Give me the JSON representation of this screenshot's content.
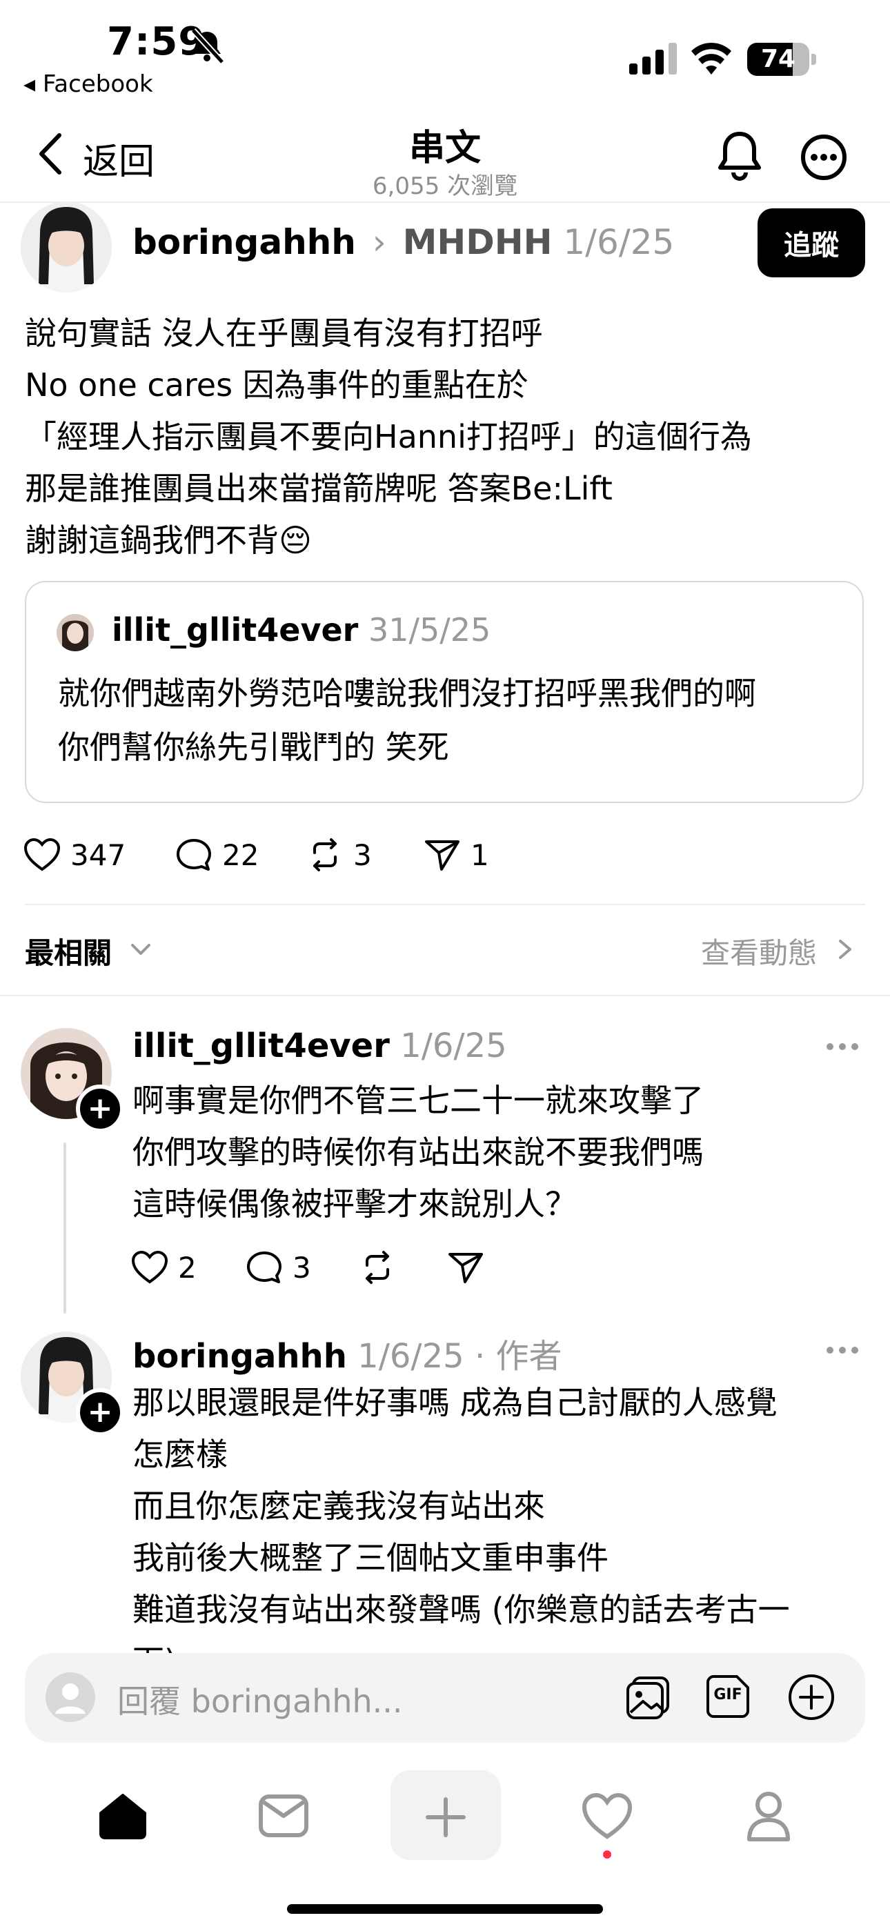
{
  "status_bar": {
    "time": "7:59",
    "back_app": "◂ Facebook",
    "battery": "74"
  },
  "nav": {
    "back_label": "返回",
    "title": "串文",
    "views": "6,055 次瀏覽"
  },
  "post": {
    "username": "boringahhh",
    "separator": "›",
    "tag": "MHDHH",
    "date": "1/6/25",
    "follow_label": "追蹤",
    "body": "說句實話 沒人在乎團員有沒有打招呼\nNo one cares 因為事件的重點在於\n「經理人指示團員不要向Hanni打招呼」的這個行為\n那是誰推團員出來當擋箭牌呢 答案Be:Lift\n謝謝這鍋我們不背",
    "emoji": "😔",
    "quote": {
      "username": "illit_gllit4ever",
      "date": "31/5/25",
      "body": "就你們越南外勞范哈嘍說我們沒打招呼黑我們的啊\n你們幫你絲先引戰鬥的 笑死"
    },
    "actions": {
      "likes": "347",
      "comments": "22",
      "reposts": "3",
      "shares": "1"
    }
  },
  "sort": {
    "label": "最相關",
    "activity_link": "查看動態"
  },
  "replies": [
    {
      "username": "illit_gllit4ever",
      "date": "1/6/25",
      "body": "啊事實是你們不管三七二十一就來攻擊了\n你們攻擊的時候你有站出來說不要我們嗎\n這時候偶像被抨擊才來說別人？",
      "likes": "2",
      "comments": "3"
    },
    {
      "username": "boringahhh",
      "date": "1/6/25",
      "author_tag": "· 作者",
      "body": "那以眼還眼是件好事嗎 成為自己討厭的人感覺\n怎麼樣\n而且你怎麼定義我沒有站出來\n我前後大概整了三個帖文重申事件\n難道我沒有站出來發聲嗎 (你樂意的話去考古一\n下)"
    }
  ],
  "reply_bar": {
    "placeholder": "回覆 boringahhh...",
    "gif_label": "GIF"
  },
  "tab_bar": [
    "home",
    "inbox",
    "compose",
    "activity",
    "profile"
  ],
  "colors": {
    "accent": "#000000",
    "muted": "#999999",
    "notification_dot": "#ff3040"
  }
}
